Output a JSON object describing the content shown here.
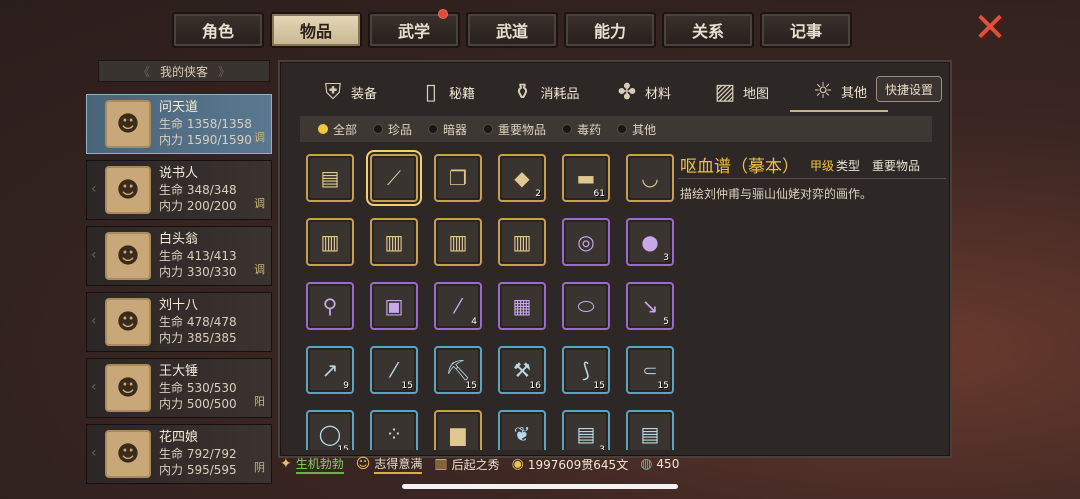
{
  "top_tabs": [
    {
      "label": "角色",
      "active": false
    },
    {
      "label": "物品",
      "active": true
    },
    {
      "label": "武学",
      "active": false,
      "badge": true
    },
    {
      "label": "武道",
      "active": false
    },
    {
      "label": "能力",
      "active": false
    },
    {
      "label": "关系",
      "active": false
    },
    {
      "label": "记事",
      "active": false
    }
  ],
  "left_header": "我的侠客",
  "heroes": [
    {
      "name": "问天道",
      "hp": "生命 1358/1358",
      "mp": "内力 1590/1590",
      "tag": "调",
      "active": true
    },
    {
      "name": "说书人",
      "hp": "生命 348/348",
      "mp": "内力 200/200",
      "tag": "调"
    },
    {
      "name": "白头翁",
      "hp": "生命 413/413",
      "mp": "内力 330/330",
      "tag": "调"
    },
    {
      "name": "刘十八",
      "hp": "生命 478/478",
      "mp": "内力 385/385",
      "tag": ""
    },
    {
      "name": "王大锤",
      "hp": "生命 530/530",
      "mp": "内力 500/500",
      "tag": "阳"
    },
    {
      "name": "花四娘",
      "hp": "生命 792/792",
      "mp": "内力 595/595",
      "tag": "阴"
    }
  ],
  "category_tabs": [
    {
      "label": "装备",
      "icon": "armor-icon"
    },
    {
      "label": "秘籍",
      "icon": "book-icon"
    },
    {
      "label": "消耗品",
      "icon": "potion-icon"
    },
    {
      "label": "材料",
      "icon": "herb-icon"
    },
    {
      "label": "地图",
      "icon": "map-icon"
    },
    {
      "label": "其他",
      "icon": "lamp-icon",
      "active": true
    }
  ],
  "quick_settings": "快捷设置",
  "filters": [
    {
      "label": "全部",
      "on": true
    },
    {
      "label": "珍品",
      "on": false
    },
    {
      "label": "暗器",
      "on": false
    },
    {
      "label": "重要物品",
      "on": false
    },
    {
      "label": "毒药",
      "on": false
    },
    {
      "label": "其他",
      "on": false
    }
  ],
  "items": [
    {
      "row": 0,
      "col": 0,
      "border": "gold",
      "glyph": "▤",
      "qty": "",
      "icon": "scroll-icon"
    },
    {
      "row": 0,
      "col": 1,
      "border": "gold",
      "glyph": "⟋",
      "qty": "",
      "icon": "rolled-scroll-icon",
      "selected": true
    },
    {
      "row": 0,
      "col": 2,
      "border": "gold",
      "glyph": "❐",
      "qty": "",
      "icon": "letter-icon"
    },
    {
      "row": 0,
      "col": 3,
      "border": "gold",
      "glyph": "◆",
      "qty": "2",
      "icon": "crystal-icon"
    },
    {
      "row": 0,
      "col": 4,
      "border": "gold",
      "glyph": "▬",
      "qty": "61",
      "icon": "gold-ingot-icon"
    },
    {
      "row": 0,
      "col": 5,
      "border": "gold",
      "glyph": "◡",
      "qty": "",
      "icon": "bowl-icon"
    },
    {
      "row": 1,
      "col": 0,
      "border": "gold",
      "glyph": "▥",
      "qty": "",
      "icon": "blue-book-icon"
    },
    {
      "row": 1,
      "col": 1,
      "border": "gold",
      "glyph": "▥",
      "qty": "",
      "icon": "red-book-icon"
    },
    {
      "row": 1,
      "col": 2,
      "border": "gold",
      "glyph": "▥",
      "qty": "",
      "icon": "brown-book-icon"
    },
    {
      "row": 1,
      "col": 3,
      "border": "gold",
      "glyph": "▥",
      "qty": "",
      "icon": "tan-book-icon"
    },
    {
      "row": 1,
      "col": 4,
      "border": "purple",
      "glyph": "◎",
      "qty": "",
      "icon": "rope-icon"
    },
    {
      "row": 1,
      "col": 5,
      "border": "purple",
      "glyph": "●",
      "qty": "3",
      "icon": "iron-balls-icon"
    },
    {
      "row": 2,
      "col": 0,
      "border": "purple",
      "glyph": "⚲",
      "qty": "",
      "icon": "dart-icon"
    },
    {
      "row": 2,
      "col": 1,
      "border": "purple",
      "glyph": "▣",
      "qty": "",
      "icon": "pouch-icon"
    },
    {
      "row": 2,
      "col": 2,
      "border": "purple",
      "glyph": "⁄",
      "qty": "4",
      "icon": "tube-icon"
    },
    {
      "row": 2,
      "col": 3,
      "border": "purple",
      "glyph": "▦",
      "qty": "",
      "icon": "map-scroll-icon"
    },
    {
      "row": 2,
      "col": 4,
      "border": "purple",
      "glyph": "⬭",
      "qty": "",
      "icon": "pills-icon"
    },
    {
      "row": 2,
      "col": 5,
      "border": "purple",
      "glyph": "↘",
      "qty": "5",
      "icon": "knife-icon"
    },
    {
      "row": 3,
      "col": 0,
      "border": "blue",
      "glyph": "↗",
      "qty": "9",
      "icon": "arrow-icon"
    },
    {
      "row": 3,
      "col": 1,
      "border": "blue",
      "glyph": "⁄",
      "qty": "15",
      "icon": "stick-icon"
    },
    {
      "row": 3,
      "col": 2,
      "border": "blue",
      "glyph": "⛏",
      "qty": "15",
      "icon": "pickaxe-icon"
    },
    {
      "row": 3,
      "col": 3,
      "border": "blue",
      "glyph": "⚒",
      "qty": "16",
      "icon": "axe-icon"
    },
    {
      "row": 3,
      "col": 4,
      "border": "blue",
      "glyph": "⟆",
      "qty": "15",
      "icon": "bow-icon"
    },
    {
      "row": 3,
      "col": 5,
      "border": "blue",
      "glyph": "⸦",
      "qty": "15",
      "icon": "sickle-icon"
    },
    {
      "row": 4,
      "col": 0,
      "border": "blue",
      "glyph": "◯",
      "qty": "15",
      "icon": "net-icon"
    },
    {
      "row": 4,
      "col": 1,
      "border": "blue",
      "glyph": "⁘",
      "qty": "",
      "icon": "pebbles-icon"
    },
    {
      "row": 4,
      "col": 2,
      "border": "gold",
      "glyph": "▆",
      "qty": "",
      "icon": "brick-icon"
    },
    {
      "row": 4,
      "col": 3,
      "border": "blue",
      "glyph": "❦",
      "qty": "",
      "icon": "fruit-icon"
    },
    {
      "row": 4,
      "col": 4,
      "border": "blue",
      "glyph": "▤",
      "qty": "3",
      "icon": "parchment-icon"
    },
    {
      "row": 4,
      "col": 5,
      "border": "blue",
      "glyph": "▤",
      "qty": "",
      "icon": "paper-icon"
    }
  ],
  "detail": {
    "title": "呕血谱（摹本）",
    "grade": "甲级",
    "type_label": "类型",
    "type": "重要物品",
    "description": "描绘刘仲甫与骊山仙姥对弈的画作。"
  },
  "status": {
    "vigor": "生机勃勃",
    "mood": "志得意满",
    "rank": "后起之秀",
    "money": "1997609贯645文",
    "jade": "450"
  },
  "colors": {
    "accent": "#f0c040",
    "panel": "#2d2826",
    "active_tab": "#d8c8a4"
  }
}
